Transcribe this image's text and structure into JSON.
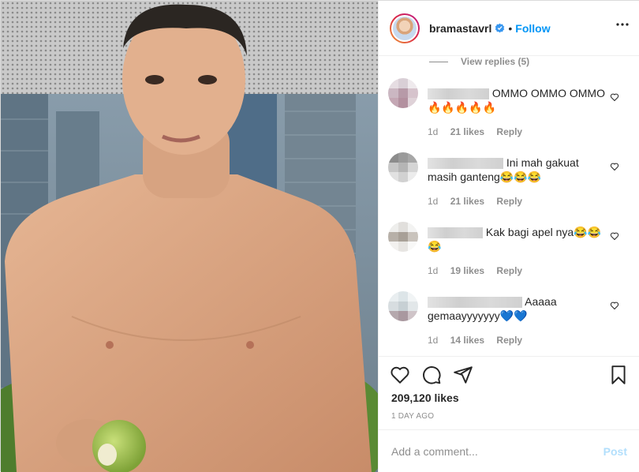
{
  "header": {
    "username": "bramastavrl",
    "separator": "•",
    "follow_label": "Follow"
  },
  "view_replies": "View replies (5)",
  "comments": [
    {
      "text": "OMMO OMMO OMMO🔥🔥🔥🔥🔥",
      "time": "1d",
      "likes": "21 likes",
      "reply_label": "Reply"
    },
    {
      "text": "Ini mah gakuat masih ganteng😂😂😂",
      "time": "1d",
      "likes": "21 likes",
      "reply_label": "Reply"
    },
    {
      "text": "Kak bagi apel nya😂😂😂",
      "time": "1d",
      "likes": "19 likes",
      "reply_label": "Reply"
    },
    {
      "text": "Aaaaa gemaayyyyyyy💙💙",
      "time": "1d",
      "likes": "14 likes",
      "reply_label": "Reply"
    }
  ],
  "likes_count": "209,120 likes",
  "post_date": "1 DAY AGO",
  "add_comment": {
    "placeholder": "Add a comment...",
    "post_label": "Post"
  },
  "colors": {
    "follow": "#0095f6",
    "post_disabled": "#b2dffc",
    "meta_gray": "#8e8e8e",
    "verified": "#3897f0"
  },
  "icons": [
    "more-icon",
    "heart-icon",
    "comment-icon",
    "share-icon",
    "bookmark-icon",
    "verified-icon"
  ]
}
